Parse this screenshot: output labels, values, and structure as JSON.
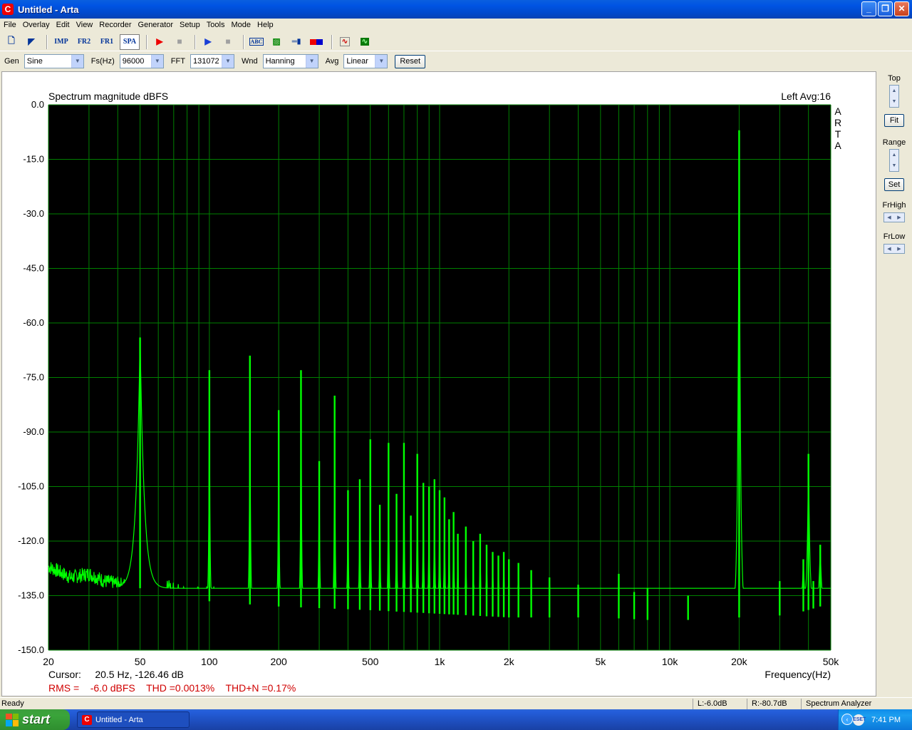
{
  "window": {
    "title": "Untitled - Arta",
    "app_icon_letter": "C",
    "min": "_",
    "max": "❐",
    "close": "✕"
  },
  "menu": [
    "File",
    "Overlay",
    "Edit",
    "View",
    "Recorder",
    "Generator",
    "Setup",
    "Tools",
    "Mode",
    "Help"
  ],
  "toolbar": {
    "imp": "IMP",
    "fr2": "FR2",
    "fr1": "FR1",
    "spa": "SPA"
  },
  "controls": {
    "gen_label": "Gen",
    "gen_value": "Sine",
    "fs_label": "Fs(Hz)",
    "fs_value": "96000",
    "fft_label": "FFT",
    "fft_value": "131072",
    "wnd_label": "Wnd",
    "wnd_value": "Hanning",
    "avg_label": "Avg",
    "avg_value": "Linear",
    "reset_label": "Reset"
  },
  "right_panel": {
    "top_label": "Top",
    "fit_label": "Fit",
    "range_label": "Range",
    "set_label": "Set",
    "frhigh_label": "FrHigh",
    "frlow_label": "FrLow"
  },
  "status": {
    "ready": "Ready",
    "left_level": "L:-6.0dB",
    "right_level": "R:-80.7dB",
    "mode": "Spectrum Analyzer"
  },
  "taskbar": {
    "start_label": "start",
    "task_label": "Untitled - Arta",
    "tray_icon": "ESET",
    "clock": "7:41 PM"
  },
  "colors": {
    "plot_bg": "#000000",
    "grid": "#008000",
    "trace": "#00ff00",
    "info_red": "#d00000"
  },
  "chart_data": {
    "type": "line",
    "title": "Spectrum magnitude dBFS",
    "channel_info": "Left  Avg:16",
    "side_label": "ARTA",
    "xlabel": "Frequency(Hz)",
    "x_scale": "log",
    "xlim": [
      20,
      50000
    ],
    "ylim": [
      -150,
      0
    ],
    "x_ticks": [
      {
        "v": 20,
        "t": "20"
      },
      {
        "v": 50,
        "t": "50"
      },
      {
        "v": 100,
        "t": "100"
      },
      {
        "v": 200,
        "t": "200"
      },
      {
        "v": 500,
        "t": "500"
      },
      {
        "v": 1000,
        "t": "1k"
      },
      {
        "v": 2000,
        "t": "2k"
      },
      {
        "v": 5000,
        "t": "5k"
      },
      {
        "v": 10000,
        "t": "10k"
      },
      {
        "v": 20000,
        "t": "20k"
      },
      {
        "v": 50000,
        "t": "50k"
      }
    ],
    "y_ticks": [
      {
        "v": 0,
        "t": "0.0"
      },
      {
        "v": -15,
        "t": "-15.0"
      },
      {
        "v": -30,
        "t": "-30.0"
      },
      {
        "v": -45,
        "t": "-45.0"
      },
      {
        "v": -60,
        "t": "-60.0"
      },
      {
        "v": -75,
        "t": "-75.0"
      },
      {
        "v": -90,
        "t": "-90.0"
      },
      {
        "v": -105,
        "t": "-105.0"
      },
      {
        "v": -120,
        "t": "-120.0"
      },
      {
        "v": -135,
        "t": "-135.0"
      },
      {
        "v": -150,
        "t": "-150.0"
      }
    ],
    "grid": true,
    "cursor_text": "Cursor:     20.5 Hz, -126.46 dB",
    "rms_text": "RMS =    -6.0 dBFS    THD =0.0013%    THD+N =0.17%",
    "noise_floor": [
      [
        20,
        -127
      ],
      [
        25,
        -130
      ],
      [
        30,
        -129
      ],
      [
        35,
        -131
      ],
      [
        42,
        -132
      ],
      [
        60,
        -134
      ],
      [
        80,
        -136
      ],
      [
        120,
        -137
      ],
      [
        200,
        -138
      ],
      [
        500,
        -139
      ],
      [
        1000,
        -140
      ],
      [
        2000,
        -141
      ],
      [
        5000,
        -141
      ],
      [
        10000,
        -142
      ],
      [
        18000,
        -141
      ],
      [
        25000,
        -141
      ],
      [
        35000,
        -140
      ],
      [
        45000,
        -138
      ],
      [
        50000,
        -139
      ]
    ],
    "peaks": [
      {
        "f": 50,
        "db": -64
      },
      {
        "f": 100,
        "db": -73
      },
      {
        "f": 150,
        "db": -69
      },
      {
        "f": 200,
        "db": -84
      },
      {
        "f": 250,
        "db": -73
      },
      {
        "f": 300,
        "db": -98
      },
      {
        "f": 350,
        "db": -80
      },
      {
        "f": 400,
        "db": -106
      },
      {
        "f": 450,
        "db": -103
      },
      {
        "f": 500,
        "db": -92
      },
      {
        "f": 550,
        "db": -110
      },
      {
        "f": 600,
        "db": -93
      },
      {
        "f": 650,
        "db": -107
      },
      {
        "f": 700,
        "db": -93
      },
      {
        "f": 750,
        "db": -113
      },
      {
        "f": 800,
        "db": -96
      },
      {
        "f": 850,
        "db": -104
      },
      {
        "f": 900,
        "db": -105
      },
      {
        "f": 950,
        "db": -103
      },
      {
        "f": 1000,
        "db": -106
      },
      {
        "f": 1050,
        "db": -108
      },
      {
        "f": 1100,
        "db": -114
      },
      {
        "f": 1150,
        "db": -112
      },
      {
        "f": 1200,
        "db": -118
      },
      {
        "f": 1300,
        "db": -116
      },
      {
        "f": 1400,
        "db": -120
      },
      {
        "f": 1500,
        "db": -118
      },
      {
        "f": 1600,
        "db": -121
      },
      {
        "f": 1700,
        "db": -123
      },
      {
        "f": 1800,
        "db": -124
      },
      {
        "f": 1900,
        "db": -123
      },
      {
        "f": 2000,
        "db": -125
      },
      {
        "f": 2200,
        "db": -126
      },
      {
        "f": 2500,
        "db": -128
      },
      {
        "f": 3000,
        "db": -130
      },
      {
        "f": 4000,
        "db": -132
      },
      {
        "f": 6000,
        "db": -129
      },
      {
        "f": 7000,
        "db": -134
      },
      {
        "f": 8000,
        "db": -133
      },
      {
        "f": 12000,
        "db": -135
      },
      {
        "f": 20000,
        "db": -7
      },
      {
        "f": 30000,
        "db": -131
      },
      {
        "f": 38000,
        "db": -125
      },
      {
        "f": 40000,
        "db": -96
      },
      {
        "f": 42000,
        "db": -131
      },
      {
        "f": 45000,
        "db": -121
      }
    ]
  }
}
